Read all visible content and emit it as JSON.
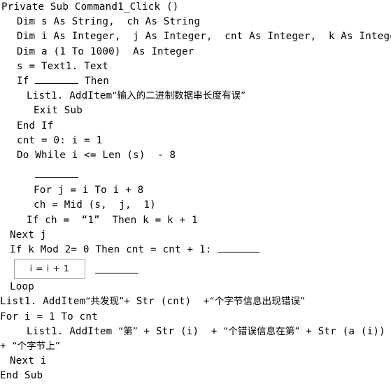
{
  "document": {
    "type": "visual-basic-code-listing",
    "language": "Visual Basic",
    "background_color": "#ffffff",
    "text_color": "#000000",
    "answer_box_border_color": "#a0a0a0"
  },
  "code": {
    "line_01": "Private Sub Command1_Click ()",
    "line_02": "Dim s As String,  ch As String",
    "line_03": "Dim i As Integer,  j As Integer,  cnt As Integer,  k As Integer",
    "line_04": "Dim a (1 To 1000)  As Integer",
    "line_05": "s = Text1. Text",
    "line_06_prefix": "If ",
    "line_06_suffix": " Then",
    "line_07_prefix": "List1. AddItem",
    "line_07_string": "“输入的二进制数据串长度有误”",
    "line_08": "Exit Sub",
    "line_09": "End If",
    "line_10": "cnt = 0: i = 1",
    "line_11": "Do While i <= Len (s)  - 8",
    "line_12_blank": "",
    "line_13": "For j = i To i + 8",
    "line_14": "ch = Mid (s,  j,  1)",
    "line_15": "If ch =  “1”  Then k = k + 1",
    "line_16": "Next j",
    "line_17_prefix": "If k Mod 2= 0 Then cnt = cnt + 1: ",
    "line_18_answer": "i = i + 1",
    "line_19": "Loop",
    "line_20_prefix": "List1. AddItem",
    "line_20_string_1": "“共发现”",
    "line_20_mid": "+ Str (cnt)  +",
    "line_20_string_2": "“个字节信息出现错误”",
    "line_21": "For i = 1 To cnt",
    "line_22_prefix": "List1. AddItem ",
    "line_22_string_1": "“第”",
    "line_22_mid_1": " + Str (i)  + ",
    "line_22_string_2": "“个错误信息在第”",
    "line_22_mid_2": " + Str (a (i))",
    "line_23_prefix": "+ ",
    "line_23_string": "“个字节上”",
    "line_24": "Next i",
    "line_25": "End Sub"
  }
}
